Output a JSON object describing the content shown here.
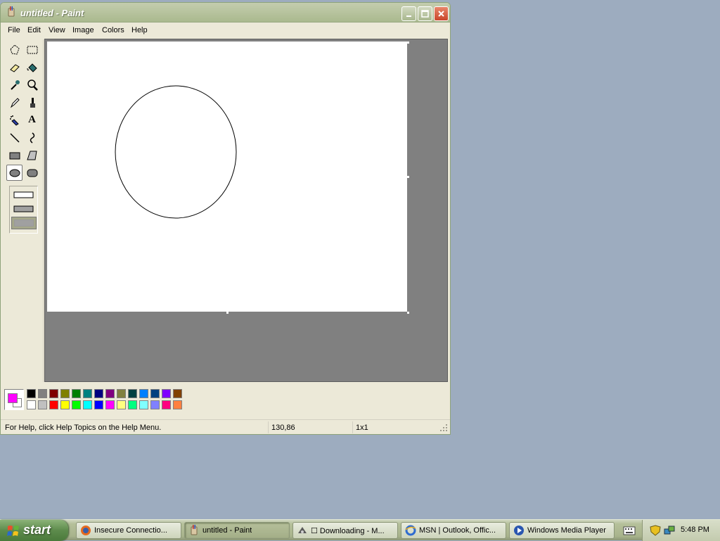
{
  "window": {
    "title": "untitled - Paint",
    "menu": [
      "File",
      "Edit",
      "View",
      "Image",
      "Colors",
      "Help"
    ]
  },
  "tools": [
    {
      "icon": "free-form-select-icon"
    },
    {
      "icon": "rect-select-icon"
    },
    {
      "icon": "eraser-icon"
    },
    {
      "icon": "fill-bucket-icon"
    },
    {
      "icon": "color-picker-icon"
    },
    {
      "icon": "magnifier-icon"
    },
    {
      "icon": "pencil-icon"
    },
    {
      "icon": "brush-icon"
    },
    {
      "icon": "airbrush-icon"
    },
    {
      "icon": "text-icon",
      "glyph": "A"
    },
    {
      "icon": "line-icon"
    },
    {
      "icon": "curve-icon"
    },
    {
      "icon": "rectangle-icon"
    },
    {
      "icon": "polygon-icon"
    },
    {
      "icon": "ellipse-icon",
      "active": true
    },
    {
      "icon": "rounded-rect-icon"
    }
  ],
  "palette": {
    "foreground": "#ff00ff",
    "background": "#ffffff",
    "row1": [
      "#000000",
      "#808080",
      "#800000",
      "#808000",
      "#008000",
      "#008080",
      "#000080",
      "#800080",
      "#808040",
      "#004040",
      "#0080ff",
      "#004080",
      "#8000ff",
      "#804000"
    ],
    "row2": [
      "#ffffff",
      "#c0c0c0",
      "#ff0000",
      "#ffff00",
      "#00ff00",
      "#00ffff",
      "#0000ff",
      "#ff00ff",
      "#ffff80",
      "#00ff80",
      "#80ffff",
      "#8080ff",
      "#ff0080",
      "#ff8040"
    ]
  },
  "status": {
    "help": "For Help, click Help Topics on the Help Menu.",
    "coords": "130,86",
    "size": "1x1"
  },
  "taskbar": {
    "start": "start",
    "tasks": [
      {
        "label": "Insecure Connectio...",
        "icon": "firefox-icon"
      },
      {
        "label": "untitled - Paint",
        "icon": "paint-icon",
        "active": true
      },
      {
        "label": "☐ Downloading - M...",
        "icon": "download-icon"
      },
      {
        "label": "MSN | Outlook, Offic...",
        "icon": "ie-icon"
      },
      {
        "label": "Windows Media Player",
        "icon": "media-player-icon"
      }
    ],
    "clock": "5:48 PM"
  }
}
